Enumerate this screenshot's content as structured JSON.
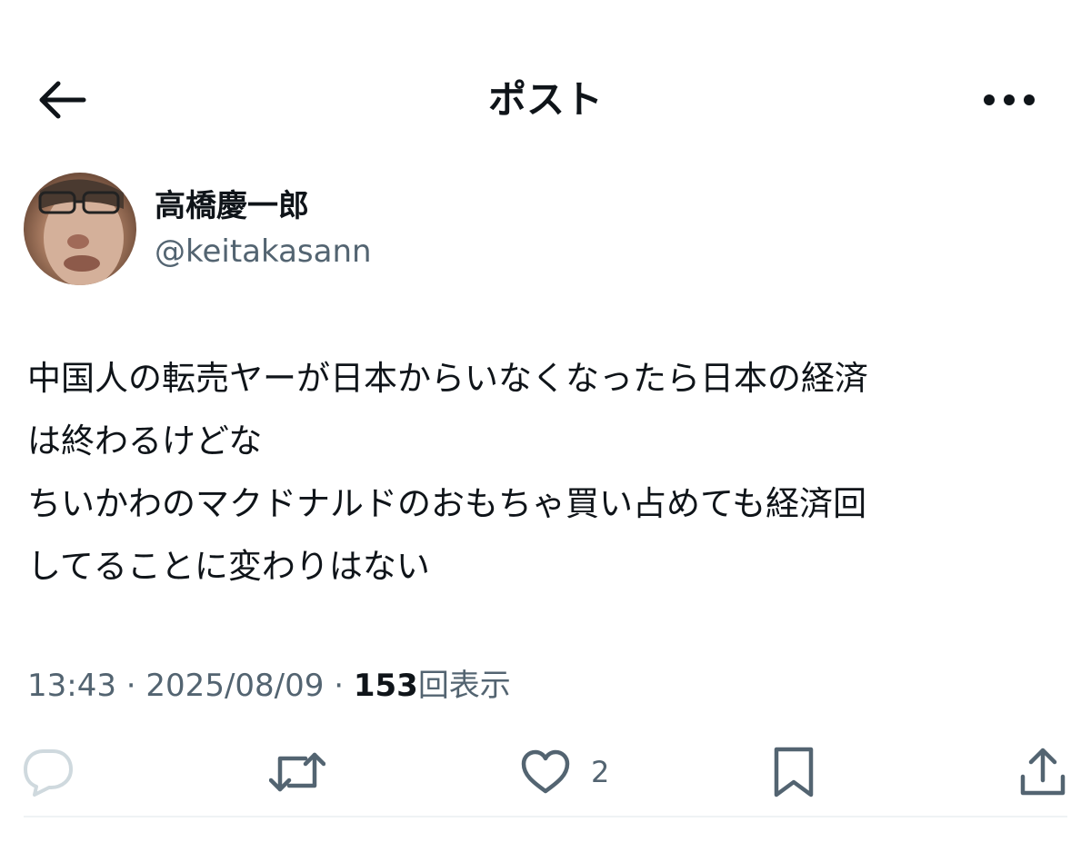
{
  "header": {
    "title": "ポスト",
    "back_icon": "arrow-left-icon",
    "more_icon": "more-horizontal-icon"
  },
  "author": {
    "display_name": "高橋慶一郎",
    "handle": "@keitakasann"
  },
  "post": {
    "lines": [
      "中国人の転売ヤーが日本からいなくなったら日本の経済",
      "は終わるけどな",
      "ちいかわのマクドナルドのおもちゃ買い占めても経済回",
      "してることに変わりはない"
    ],
    "time": "13:43",
    "separator": "·",
    "date": "2025/08/09",
    "views_count": "153",
    "views_label": "回表示"
  },
  "actions": {
    "reply_icon": "reply-icon",
    "repost_icon": "repost-icon",
    "like_icon": "heart-icon",
    "like_count": "2",
    "bookmark_icon": "bookmark-icon",
    "share_icon": "share-icon"
  },
  "colors": {
    "text_primary": "#0f1419",
    "text_secondary": "#536471",
    "reply_icon": "#cfd9de",
    "divider": "#eff3f4"
  }
}
